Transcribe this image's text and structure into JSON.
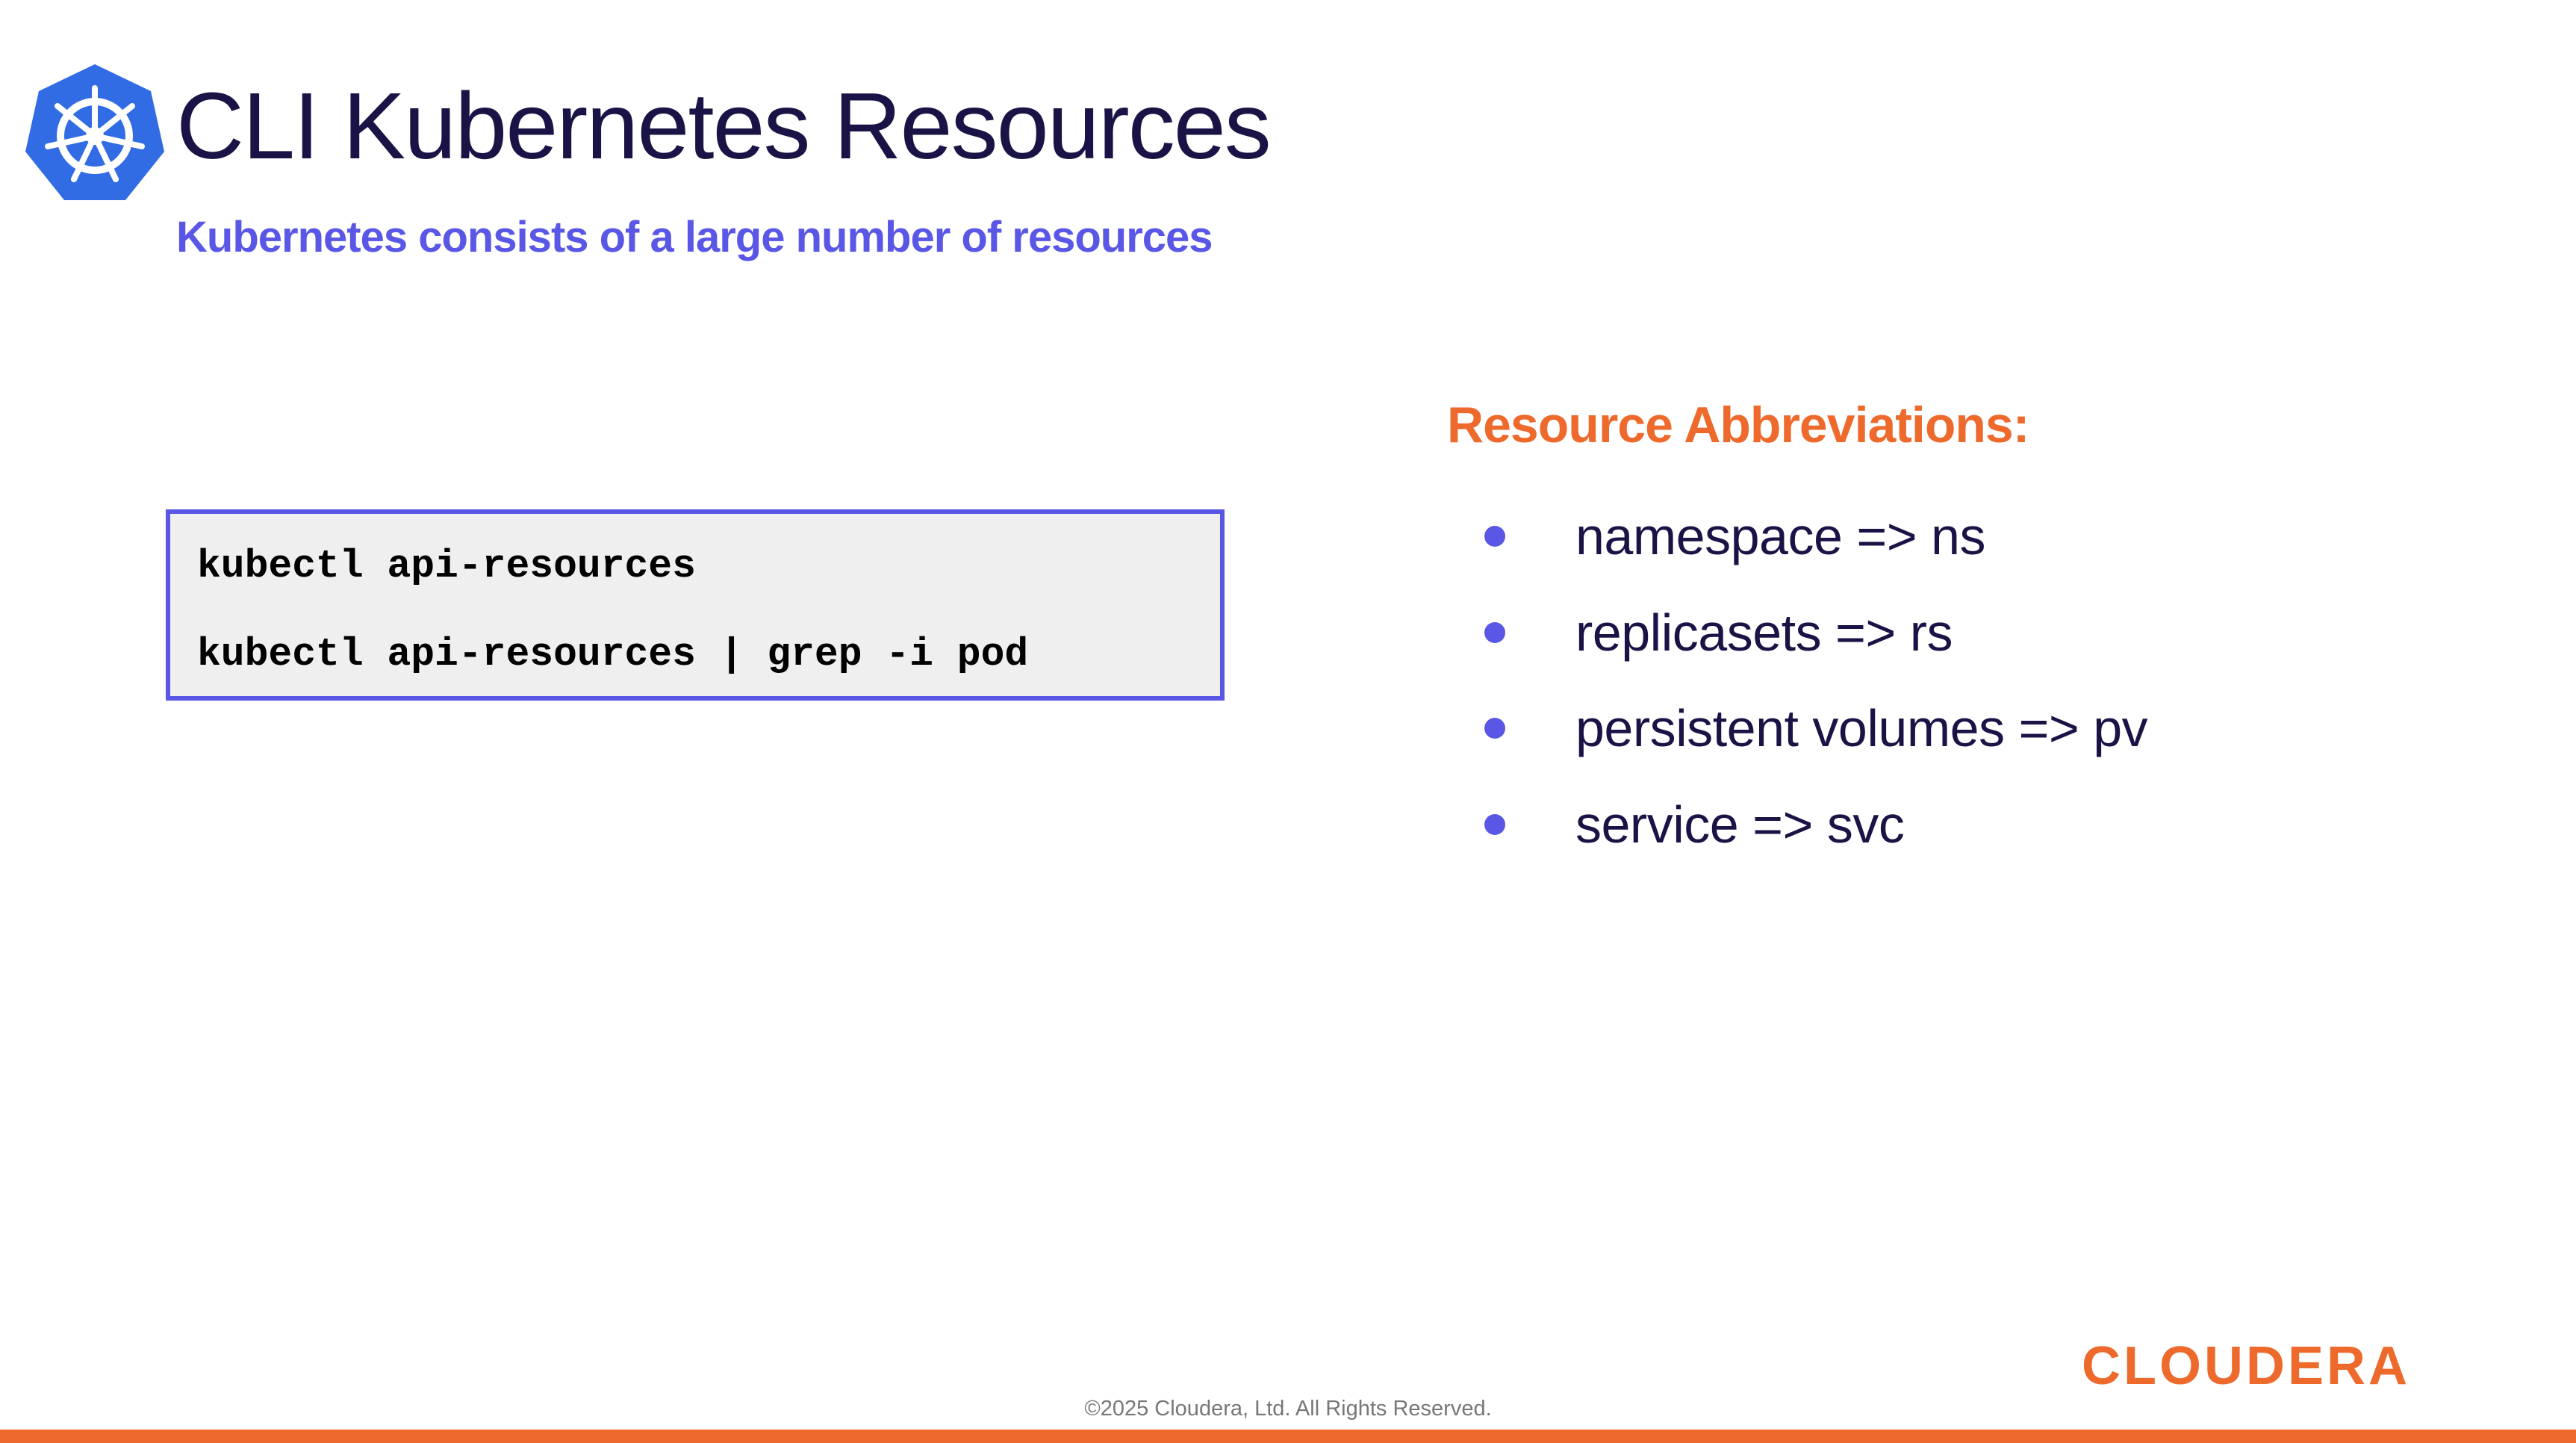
{
  "header": {
    "title": "CLI Kubernetes Resources",
    "subtitle": "Kubernetes consists of a large number of resources",
    "logo_icon": "kubernetes-helm-wheel-icon"
  },
  "code": {
    "lines": [
      "kubectl api-resources",
      "kubectl api-resources | grep -i pod"
    ]
  },
  "abbreviations": {
    "heading": "Resource Abbreviations:",
    "items": [
      "namespace => ns",
      "replicasets => rs",
      "persistent volumes => pv",
      "service => svc"
    ]
  },
  "footer": {
    "brand": "CLOUDERA",
    "copyright": "©2025 Cloudera, Ltd. All Rights Reserved."
  },
  "colors": {
    "title": "#1a1446",
    "accent_purple": "#5a57e6",
    "accent_orange": "#ee6a2c",
    "k8s_blue": "#326ce5",
    "code_bg": "#efefef"
  }
}
